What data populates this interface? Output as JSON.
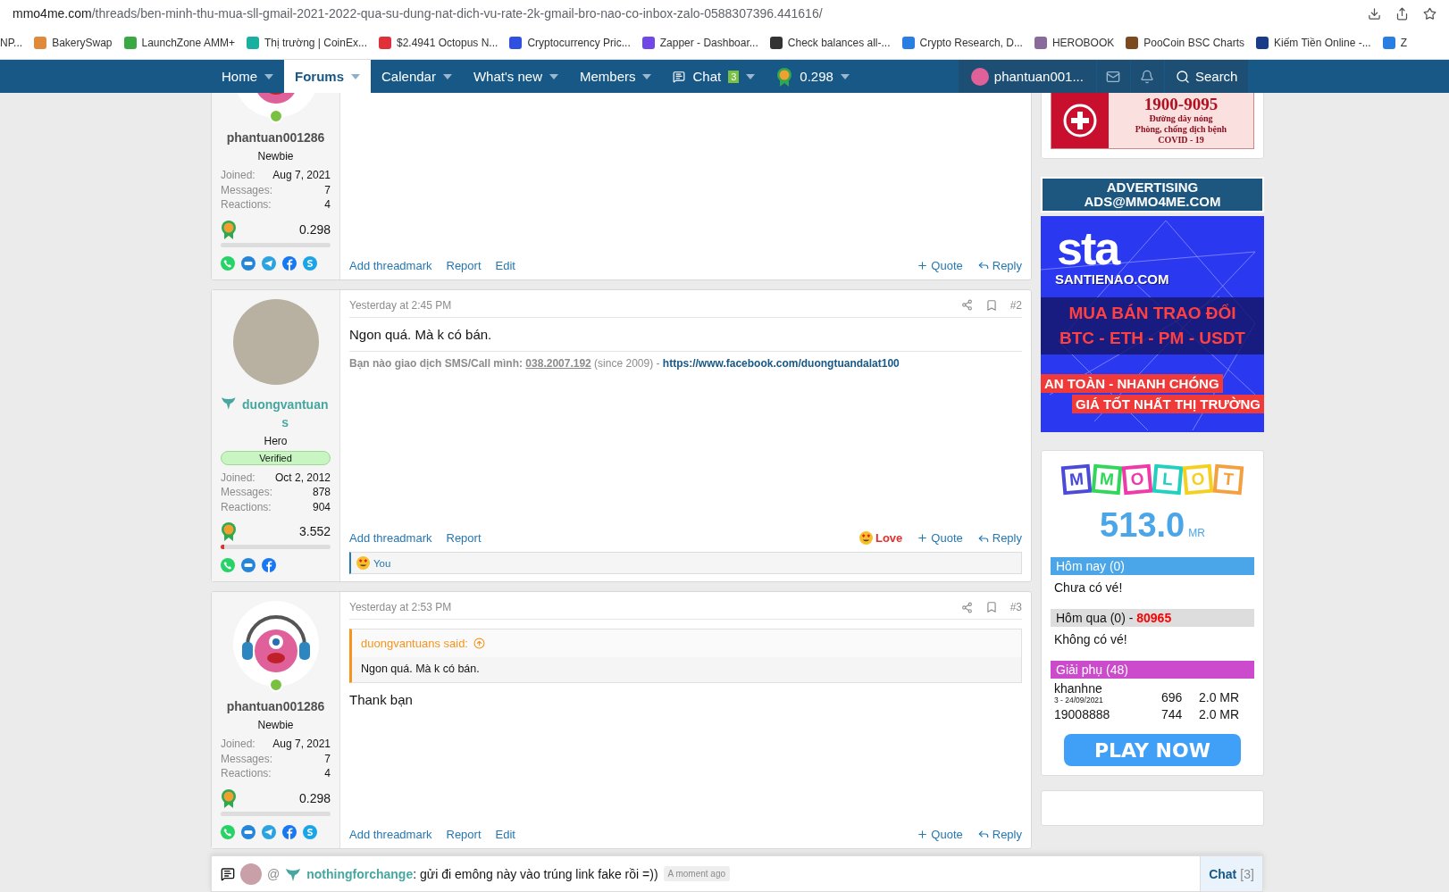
{
  "browser": {
    "url_host": "mmo4me.com",
    "url_path": "/threads/ben-minh-thu-mua-sll-gmail-2021-2022-qua-su-dung-nat-dich-vu-rate-2k-gmail-bro-nao-co-inbox-zalo-0588307396.441616/",
    "bookmarks": [
      {
        "label": "NP..."
      },
      {
        "label": "BakerySwap",
        "color": "#e08a3c"
      },
      {
        "label": "LaunchZone AMM+",
        "color": "#3aa845"
      },
      {
        "label": "Thị trường | CoinEx...",
        "color": "#1ab0a0"
      },
      {
        "label": "$2.4941 Octopus N...",
        "color": "#e0303a"
      },
      {
        "label": "Cryptocurrency Pric...",
        "color": "#3050e0"
      },
      {
        "label": "Zapper - Dashboar...",
        "color": "#7048e8"
      },
      {
        "label": "Check balances all-...",
        "color": "#333333"
      },
      {
        "label": "Crypto Research, D...",
        "color": "#2a7de1"
      },
      {
        "label": "HEROBOOK",
        "color": "#8a6a9a"
      },
      {
        "label": "PooCoin BSC Charts",
        "color": "#7a4a20"
      },
      {
        "label": "Kiếm Tiền Online -...",
        "color": "#1a3a8a"
      },
      {
        "label": "Z",
        "color": "#2a7de1"
      }
    ]
  },
  "nav": {
    "items": [
      {
        "label": "Home",
        "kind": "link",
        "selected": false
      },
      {
        "label": "Forums",
        "kind": "link",
        "selected": true
      },
      {
        "label": "Calendar",
        "kind": "link",
        "selected": false
      },
      {
        "label": "What's new",
        "kind": "link",
        "selected": false
      },
      {
        "label": "Members",
        "kind": "link",
        "selected": false
      },
      {
        "label": "Chat",
        "kind": "chat",
        "badge": "3",
        "selected": false
      },
      {
        "label": "0.298",
        "kind": "balance",
        "selected": false
      }
    ],
    "user": "phantuan001...",
    "search": "Search"
  },
  "posts": [
    {
      "user": {
        "name": "phantuan001286",
        "kind": "member",
        "title": "Newbie",
        "online": true,
        "stats": [
          {
            "label": "Joined:",
            "value": "Aug 7, 2021"
          },
          {
            "label": "Messages:",
            "value": "7"
          },
          {
            "label": "Reactions:",
            "value": "4"
          }
        ],
        "balance": "0.298",
        "level": 0,
        "socials": [
          {
            "kind": "phone"
          },
          {
            "kind": "zalo"
          },
          {
            "kind": "telegram"
          },
          {
            "kind": "facebook"
          },
          {
            "kind": "skype"
          }
        ]
      },
      "actions": [
        "Add threadmark",
        "Report",
        "Edit"
      ],
      "right_actions": [
        {
          "kind": "quote",
          "label": "Quote"
        },
        {
          "kind": "reply",
          "label": "Reply"
        }
      ]
    },
    {
      "user": {
        "name": "duongvantuans",
        "kind": "hero",
        "title": "Hero",
        "badge": "Verified",
        "online": false,
        "stats": [
          {
            "label": "Joined:",
            "value": "Oct 2, 2012"
          },
          {
            "label": "Messages:",
            "value": "878"
          },
          {
            "label": "Reactions:",
            "value": "904"
          }
        ],
        "balance": "3.552",
        "level": 0.03,
        "socials": [
          {
            "kind": "phone"
          },
          {
            "kind": "zalo"
          },
          {
            "kind": "facebook"
          }
        ]
      },
      "time": "Yesterday at 2:45 PM",
      "number": "#2",
      "body": "Ngon quá. Mà k có bán.",
      "signature": {
        "prefix": "Bạn nào giao dịch SMS/Call mình:",
        "phone": "038.2007.192",
        "middle": "(since 2009) -",
        "link": "https://www.facebook.com/duongtuandalat100"
      },
      "actions": [
        "Add threadmark",
        "Report"
      ],
      "right_actions": [
        {
          "kind": "love",
          "label": "Love"
        },
        {
          "kind": "quote",
          "label": "Quote"
        },
        {
          "kind": "reply",
          "label": "Reply"
        }
      ],
      "reactions": "You"
    },
    {
      "user": {
        "name": "phantuan001286",
        "kind": "member",
        "title": "Newbie",
        "online": true,
        "stats": [
          {
            "label": "Joined:",
            "value": "Aug 7, 2021"
          },
          {
            "label": "Messages:",
            "value": "7"
          },
          {
            "label": "Reactions:",
            "value": "4"
          }
        ],
        "balance": "0.298",
        "level": 0,
        "socials": [
          {
            "kind": "phone"
          },
          {
            "kind": "zalo"
          },
          {
            "kind": "telegram"
          },
          {
            "kind": "facebook"
          },
          {
            "kind": "skype"
          }
        ]
      },
      "time": "Yesterday at 2:53 PM",
      "number": "#3",
      "quote": {
        "author": "duongvantuans said:",
        "text": "Ngon quá. Mà k có bán."
      },
      "body": "Thank bạn",
      "actions": [
        "Add threadmark",
        "Report",
        "Edit"
      ],
      "right_actions": [
        {
          "kind": "quote",
          "label": "Quote"
        },
        {
          "kind": "reply",
          "label": "Reply"
        }
      ]
    }
  ],
  "sidebar": {
    "hotline": {
      "number": "1900-9095",
      "line1": "Đường dây nóng",
      "line2": "Phòng, chống dịch bệnh",
      "line3": "COVID - 19"
    },
    "advertising": [
      "ADVERTISING",
      "ADS@MMO4ME.COM"
    ],
    "exchange_ad": {
      "logo": "sta",
      "site": "SANTIENAO.COM",
      "line1": "MUA BÁN TRAO ĐỔI",
      "line2": "BTC - ETH - PM - USDT",
      "line3": "AN TOÀN - NHANH CHÓNG",
      "line4": "GIÁ TỐT NHẤT THỊ TRƯỜNG"
    },
    "lottery": {
      "letters": [
        {
          "char": "M",
          "color": "#4b4bd8"
        },
        {
          "char": "M",
          "color": "#33d65a"
        },
        {
          "char": "O",
          "color": "#f03aa8"
        },
        {
          "char": "L",
          "color": "#22d0c0"
        },
        {
          "char": "O",
          "color": "#f5d020"
        },
        {
          "char": "T",
          "color": "#f5a040"
        }
      ],
      "amount": "513.0",
      "unit": "MR",
      "sections": [
        {
          "title": "Hôm nay  (0)",
          "color": "#4aa6e8",
          "light": true,
          "note": "Chưa có vé!"
        },
        {
          "title": "Hôm qua  (0) - ",
          "highlight": "80965",
          "color": "#dddddd",
          "light": false,
          "note": "Không có vé!"
        },
        {
          "title": "Giải phụ  (48)",
          "color": "#cc4acc",
          "light": true,
          "rows": [
            {
              "name": "khanhne",
              "date": "3 - 24/09/2021",
              "number": "696",
              "prize": "2.0 MR"
            },
            {
              "name": "19008888",
              "number": "744",
              "prize": "2.0 MR"
            }
          ]
        }
      ],
      "button": "PLAY NOW"
    }
  },
  "chat_bar": {
    "mention": "@",
    "user": "nothingforchange",
    "message": ": gửi đi emông này vào trúng link fake rồi =))",
    "time": "A moment ago",
    "label": "Chat",
    "count": "[3]"
  }
}
